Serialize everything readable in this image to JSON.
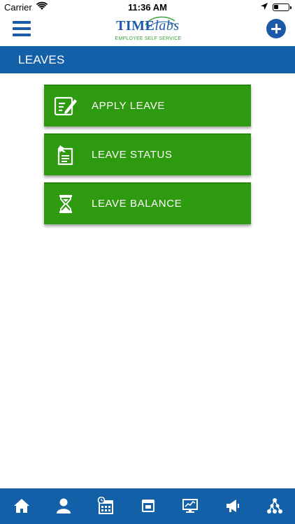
{
  "status_bar": {
    "carrier": "Carrier",
    "time": "11:36 AM"
  },
  "header": {
    "logo_word_a": "TIME",
    "logo_word_b": "labs",
    "logo_tagline": "EMPLOYEE SELF SERVICE",
    "menu_icon": "hamburger-menu-icon",
    "add_icon": "plus-circle-icon"
  },
  "page": {
    "title": "LEAVES"
  },
  "menu": {
    "items": [
      {
        "label": "APPLY LEAVE",
        "icon": "edit-document-icon"
      },
      {
        "label": "LEAVE STATUS",
        "icon": "pinned-note-icon"
      },
      {
        "label": "LEAVE BALANCE",
        "icon": "hourglass-icon"
      }
    ]
  },
  "bottom_nav": {
    "items": [
      {
        "icon": "home-icon"
      },
      {
        "icon": "user-icon"
      },
      {
        "icon": "calendar-clock-icon"
      },
      {
        "icon": "calendar-icon"
      },
      {
        "icon": "monitor-chart-icon"
      },
      {
        "icon": "megaphone-icon"
      },
      {
        "icon": "network-tree-icon"
      }
    ]
  },
  "colors": {
    "brand_blue": "#1460a8",
    "button_green": "#2e9a0f",
    "logo_green": "#3aa33a"
  }
}
